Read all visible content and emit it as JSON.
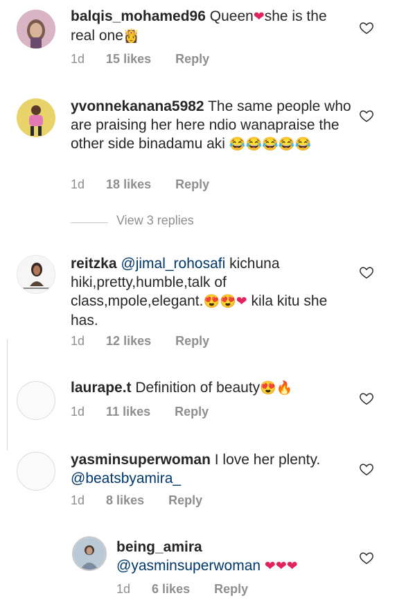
{
  "comments": [
    {
      "user": "balqis_mohamed96",
      "text": "Queen",
      "emoji": "❤",
      "text2": "she is the real one",
      "emoji2": "👸",
      "time": "1d",
      "likes": "15 likes",
      "reply": "Reply"
    },
    {
      "user": "yvonnekanana5982",
      "text": "The same people who are praising her here ndio wanapraise the other side binadamu aki",
      "emoji": "😂😂😂😂😂",
      "time": "1d",
      "likes": "18 likes",
      "reply": "Reply"
    },
    {
      "user": "reitzka",
      "mention": "@jimal_rohosafi",
      "text": "kichuna hiki,pretty,humble,talk of class,mpole,elegant.",
      "emoji": "😍😍❤",
      "text2": "kila kitu she has.",
      "time": "1d",
      "likes": "12 likes",
      "reply": "Reply"
    },
    {
      "user": "laurape.t",
      "text": "Definition of beauty",
      "emoji": "😍🔥",
      "time": "1d",
      "likes": "11 likes",
      "reply": "Reply"
    },
    {
      "user": "yasminsuperwoman",
      "text": "I love her plenty.",
      "mention": "@beatsbyamira_",
      "time": "1d",
      "likes": "8 likes",
      "reply": "Reply"
    },
    {
      "user": "being_amira",
      "mention": "@yasminsuperwoman",
      "emoji": "❤❤❤",
      "time": "1d",
      "likes": "6 likes",
      "reply": "Reply"
    }
  ],
  "view_replies": "View 3 replies",
  "colors": {
    "text": "#262626",
    "meta": "#8e8e8e",
    "mention": "#00376b",
    "heart": "#e0245e"
  }
}
